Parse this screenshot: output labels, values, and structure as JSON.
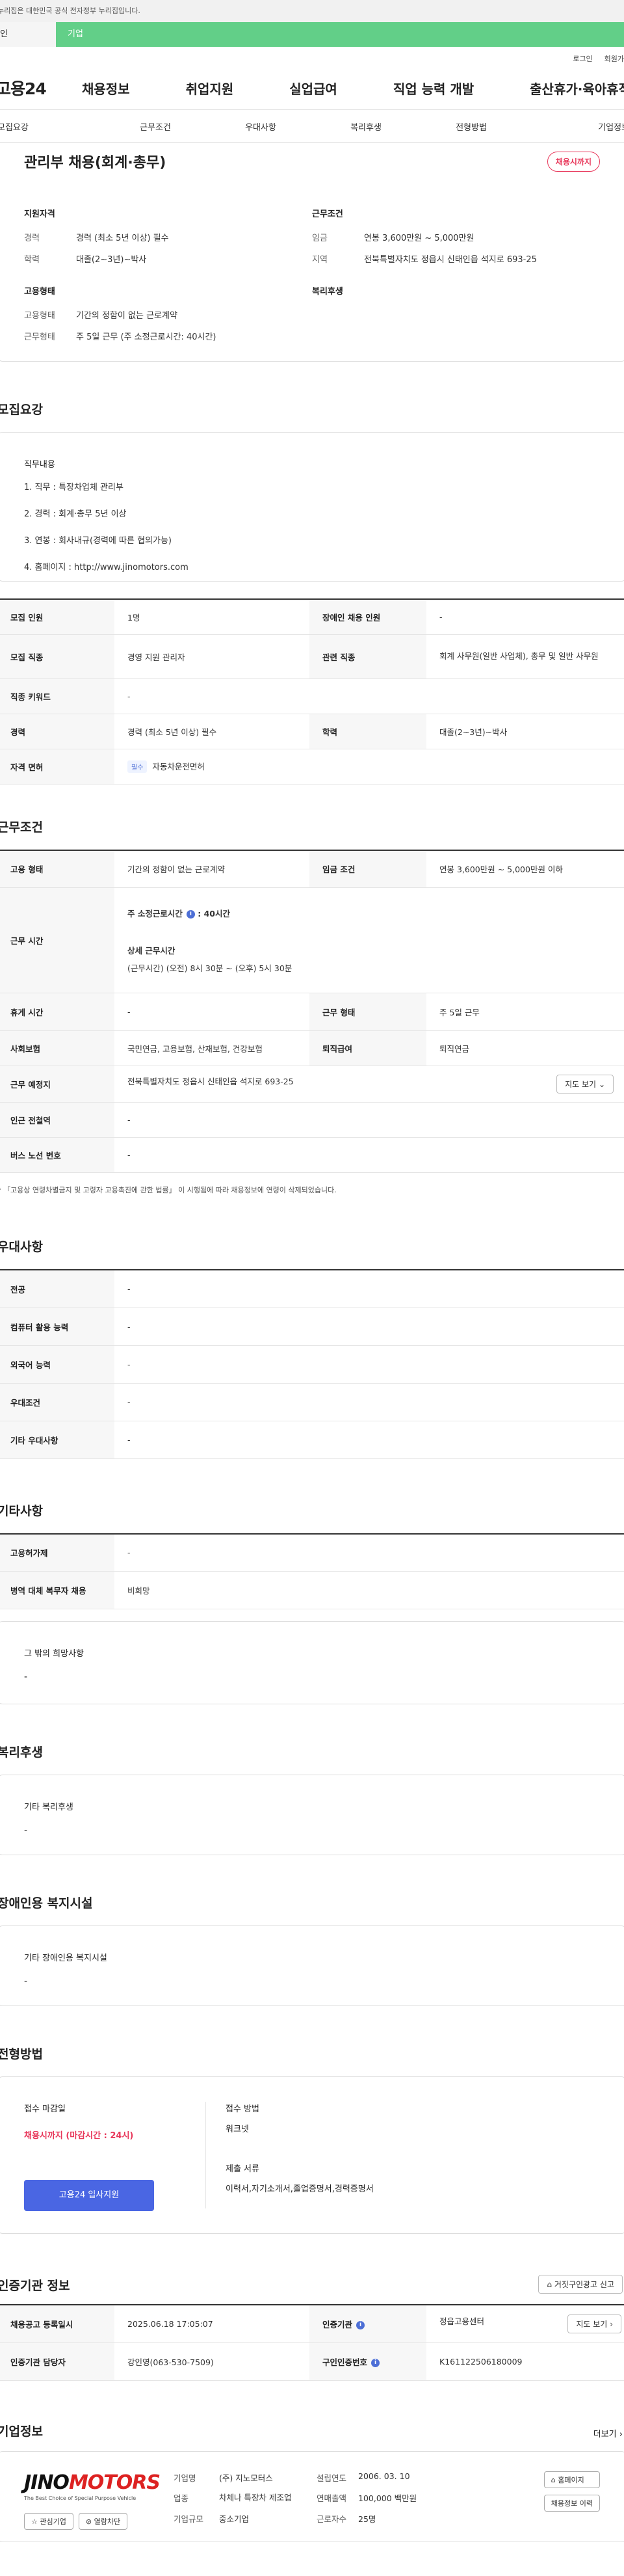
{
  "gov_banner": "누리집은 대한민국 공식 전자정부 누리집입니다.",
  "top_tabs": {
    "personal": "인",
    "company": "기업"
  },
  "util": {
    "login": "로그인",
    "join": "회원가"
  },
  "gnb": {
    "logo": "고용24",
    "items": [
      "채용정보",
      "취업지원",
      "실업급여",
      "직업 능력 개발",
      "출산휴가·육아휴직"
    ]
  },
  "subtabs": [
    "모집요강",
    "근무조건",
    "우대사항",
    "복리후생",
    "전형방법",
    "기업정보"
  ],
  "summary": {
    "title": "관리부 채용(회계·총무)",
    "badge": "채용시까지",
    "qual_heading": "지원자격",
    "career_k": "경력",
    "career_v": "경력 (최소 5년 이상) 필수",
    "edu_k": "학력",
    "edu_v": "대졸(2~3년)~박사",
    "cond_heading": "근무조건",
    "wage_k": "임금",
    "wage_v": "연봉 3,600만원 ~ 5,000만원",
    "area_k": "지역",
    "area_v": "전북특별자치도 정읍시 신태인읍 석지로 693-25",
    "emp_heading": "고용형태",
    "type_k": "고용형태",
    "type_v": "기간의 정함이 없는 근로계약",
    "time_k": "근무형태",
    "time_v": "주 5일 근무 (주 소정근로시간: 40시간)",
    "welfare_heading": "복리후생"
  },
  "recruit": {
    "title": "모집요강",
    "duty_heading": "직무내용",
    "duty_lines": [
      "1. 직무 : 특장차업체 관리부",
      "2. 경력 : 회계·총무 5년 이상",
      "3. 연봉 : 회사내규(경력에 따른 협의가능)",
      "4. 홈페이지 : http://www.jinomotors.com"
    ],
    "rows": {
      "headcount_k": "모집 인원",
      "headcount_v": "1명",
      "disabled_k": "장애인 채용 인원",
      "disabled_v": "-",
      "job_k": "모집 직종",
      "job_v": "경영 지원 관리자",
      "related_k": "관련 직종",
      "related_v": "회계 사무원(일반 사업체), 총무 및 일반 사무원",
      "keyword_k": "직종 키워드",
      "keyword_v": "-",
      "career_k": "경력",
      "career_v": "경력 (최소 5년 이상) 필수",
      "edu_k": "학력",
      "edu_v": "대졸(2~3년)~박사",
      "license_k": "자격 면허",
      "license_tag": "필수",
      "license_v": "자동차운전면허"
    }
  },
  "work": {
    "title": "근무조건",
    "type_k": "고용 형태",
    "type_v": "기간의 정함이 없는 근로계약",
    "wage_k": "임금 조건",
    "wage_v": "연봉 3,600만원 ~ 5,000만원 이하",
    "hours_k": "근무 시간",
    "hours_main": "주 소정근로시간",
    "hours_main_v": ": 40시간",
    "hours_detail_h": "상세 근무시간",
    "hours_detail_v": "(근무시간) (오전) 8시 30분 ~ (오후) 5시 30분",
    "rest_k": "휴게 시간",
    "rest_v": "-",
    "form_k": "근무 형태",
    "form_v": "주 5일 근무",
    "ins_k": "사회보험",
    "ins_v": "국민연금, 고용보험, 산재보험, 건강보험",
    "ret_k": "퇴직급여",
    "ret_v": "퇴직연금",
    "place_k": "근무 예정지",
    "place_v": "전북특별자치도 정읍시 신태인읍 석지로 693-25",
    "map_btn": "지도 보기",
    "station_k": "인근 전철역",
    "station_v": "-",
    "bus_k": "버스 노선 번호",
    "bus_v": "-",
    "note": "* 「고용상 연령차별금지 및 고령자 고용촉진에 관한 법률」 이 시행됨에 따라 채용정보에 연령이 삭제되었습니다."
  },
  "pref": {
    "title": "우대사항",
    "rows": [
      {
        "k": "전공",
        "v": "-"
      },
      {
        "k": "컴퓨터 활용 능력",
        "v": "-"
      },
      {
        "k": "외국어 능력",
        "v": "-"
      },
      {
        "k": "우대조건",
        "v": "-"
      },
      {
        "k": "기타 우대사항",
        "v": "-"
      }
    ]
  },
  "etc": {
    "title": "기타사항",
    "rows": [
      {
        "k": "고용허가제",
        "v": "-"
      },
      {
        "k": "병역 대체 복무자 채용",
        "v": "비희망"
      }
    ],
    "wish_h": "그 밖의 희망사항",
    "wish_v": "-"
  },
  "welfare": {
    "title": "복리후생",
    "h": "기타 복리후생",
    "v": "-"
  },
  "facility": {
    "title": "장애인용 복지시설",
    "h": "기타 장애인용 복지시설",
    "v": "-"
  },
  "process": {
    "title": "전형방법",
    "deadline_h": "접수 마감일",
    "deadline_v": "채용시까지 (마감시간 : 24시)",
    "apply_btn": "고용24 입사지원",
    "method_h": "접수 방법",
    "method_v": "워크넷",
    "docs_h": "제출 서류",
    "docs_v": "이력서,자기소개서,졸업증명서,경력증명서"
  },
  "agency": {
    "title": "인증기관 정보",
    "report_btn": "거짓구인광고 신고",
    "reg_k": "채용공고 등록일시",
    "reg_v": "2025.06.18 17:05:07",
    "org_k": "인증기관",
    "org_v": "정읍고용센터",
    "map_btn": "지도 보기",
    "mgr_k": "인증기관 담당자",
    "mgr_v": "강인영(063-530-7509)",
    "num_k": "구인인증번호",
    "num_v": "K161122506180009"
  },
  "company": {
    "title": "기업정보",
    "more": "더보기",
    "logo_a": "JINO",
    "logo_b": "MOTORS",
    "logo_sub": "The Best Choice of Special Purpose Vehicle",
    "interest_btn": "관심기업",
    "block_btn": "열람차단",
    "name_k": "기업명",
    "name_v": "(주) 지노모터스",
    "ind_k": "업종",
    "ind_v": "차체나 특장차 제조업",
    "size_k": "기업규모",
    "size_v": "중소기업",
    "est_k": "설립연도",
    "est_v": "2006. 03. 10",
    "sales_k": "연매출액",
    "sales_v": "100,000 백만원",
    "emp_k": "근로자수",
    "emp_v": "25명",
    "home_btn": "홈페이지",
    "history_btn": "채용정보 이력"
  }
}
